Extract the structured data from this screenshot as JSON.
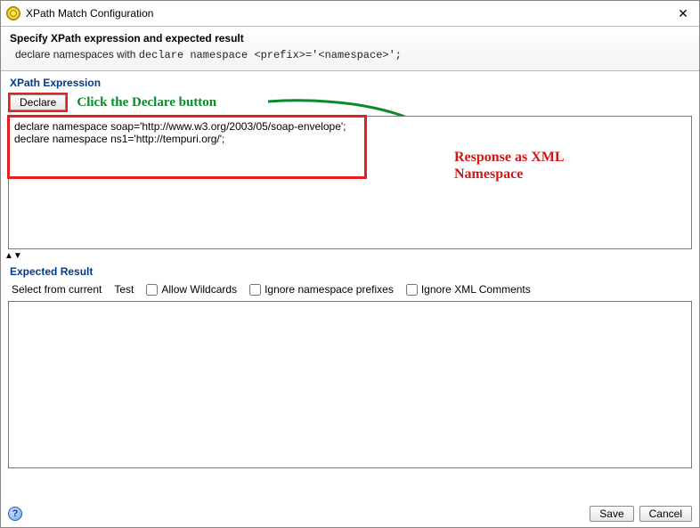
{
  "window": {
    "title": "XPath Match Configuration",
    "close_glyph": "✕"
  },
  "header": {
    "title": "Specify XPath expression and expected result",
    "subtitle_pre": "declare namespaces with ",
    "subtitle_code": "declare namespace <prefix>='<namespace>';"
  },
  "xpath": {
    "section_title": "XPath Expression",
    "declare_label": "Declare",
    "text": "declare namespace soap='http://www.w3.org/2003/05/soap-envelope';\ndeclare namespace ns1='http://tempuri.org/';"
  },
  "annotations": {
    "green": "Click the Declare button",
    "red_line1": "Response as XML",
    "red_line2": "Namespace"
  },
  "expected": {
    "section_title": "Expected Result",
    "select_from_current": "Select from current",
    "test": "Test",
    "allow_wildcards": "Allow Wildcards",
    "ignore_ns_prefixes": "Ignore namespace prefixes",
    "ignore_xml_comments": "Ignore XML Comments",
    "text": ""
  },
  "footer": {
    "help_glyph": "?",
    "save": "Save",
    "cancel": "Cancel"
  }
}
